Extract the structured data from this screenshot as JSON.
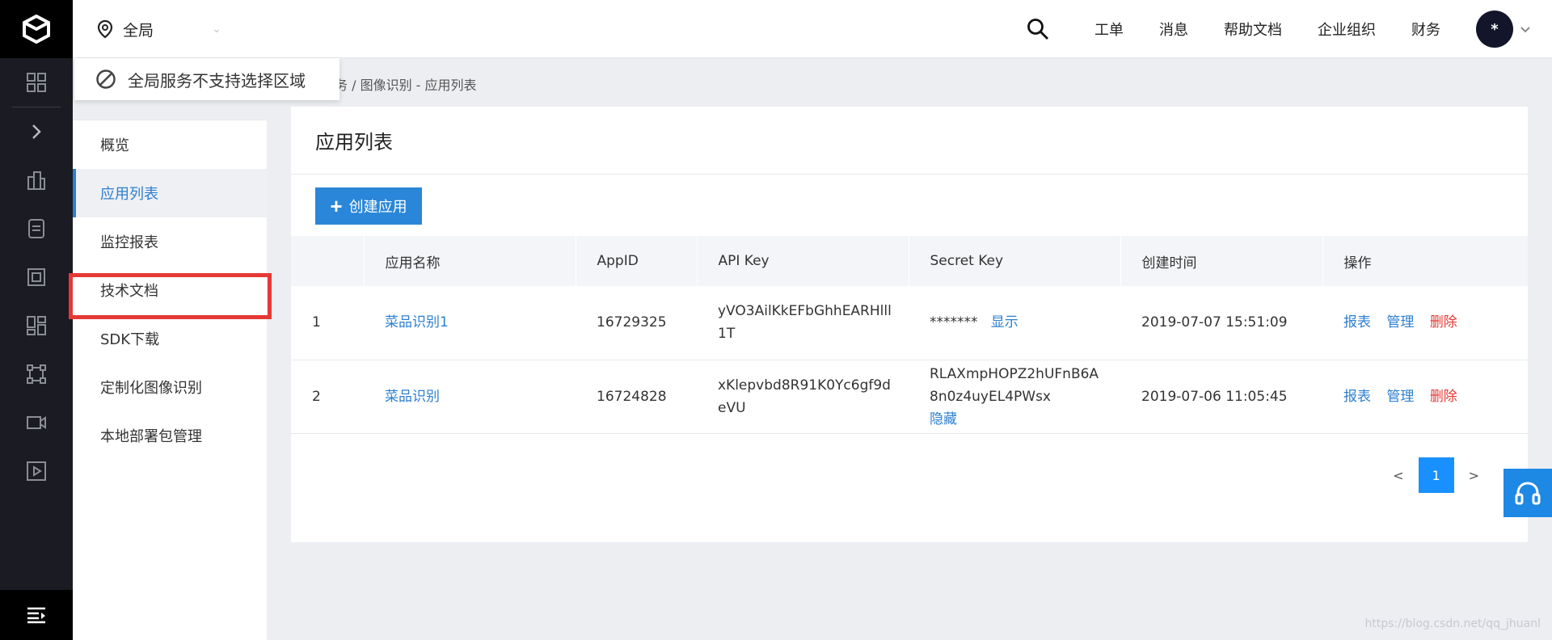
{
  "header": {
    "region_label": "全局",
    "nav": [
      "工单",
      "消息",
      "帮助文档",
      "企业组织",
      "财务"
    ],
    "avatar_text": "*"
  },
  "region_popup": {
    "text": "全局服务不支持选择区域"
  },
  "breadcrumb": "务  /  图像识别 - 应用列表",
  "sidebar": {
    "items": [
      {
        "label": "概览"
      },
      {
        "label": "应用列表"
      },
      {
        "label": "监控报表"
      },
      {
        "label": "技术文档"
      },
      {
        "label": "SDK下载"
      },
      {
        "label": "定制化图像识别"
      },
      {
        "label": "本地部署包管理"
      }
    ]
  },
  "panel": {
    "title": "应用列表",
    "create_label": "创建应用",
    "columns": [
      "",
      "应用名称",
      "AppID",
      "API Key",
      "Secret Key",
      "创建时间",
      "操作"
    ],
    "rows": [
      {
        "index": "1",
        "name": "菜品识别1",
        "appid": "16729325",
        "api_key": "yVO3AilKkEFbGhhEARHlll1T",
        "secret_key": "*******",
        "secret_action": "显示",
        "created": "2019-07-07 15:51:09",
        "ops": [
          "报表",
          "管理",
          "删除"
        ]
      },
      {
        "index": "2",
        "name": "菜品识别",
        "appid": "16724828",
        "api_key": "xKlepvbd8R91K0Yc6gf9deVU",
        "secret_key": "RLAXmpHOPZ2hUFnB6A8n0z4uyEL4PWsx",
        "secret_action": "隐藏",
        "created": "2019-07-06 11:05:45",
        "ops": [
          "报表",
          "管理",
          "删除"
        ]
      }
    ],
    "pager": {
      "prev": "<",
      "current": "1",
      "next": ">"
    }
  },
  "watermark": "https://blog.csdn.net/qq_jhuanl",
  "colors": {
    "accent": "#2d7fd0",
    "danger": "#e53935",
    "rail": "#1a1b23",
    "highlight_box": "#e53935"
  }
}
